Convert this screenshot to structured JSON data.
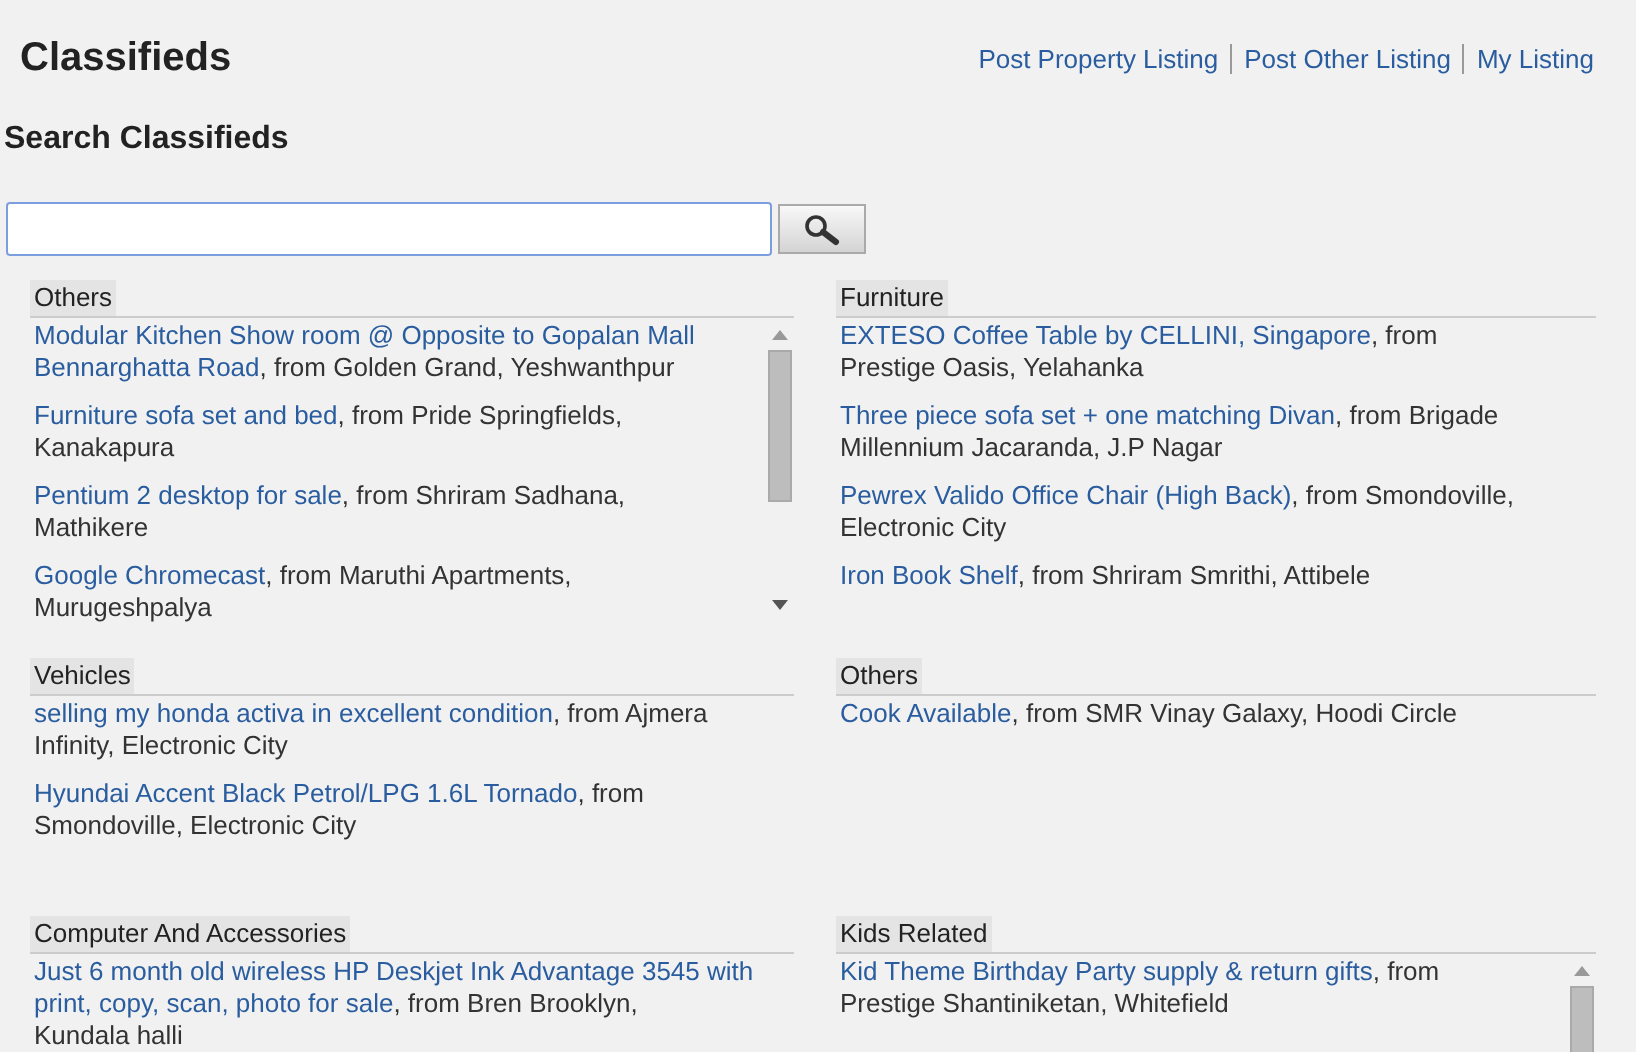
{
  "page": {
    "title": "Classifieds"
  },
  "top_links": [
    "Post Property Listing",
    "Post Other Listing",
    "My Listing"
  ],
  "search": {
    "heading": "Search Classifieds"
  },
  "sections": [
    {
      "title": "Others",
      "scrollbar": true,
      "items": [
        {
          "link": [
            "Modular Kitchen Show room @ Opposite to Gopalan Mall",
            "Bennarghatta Road"
          ],
          "detail": ", from Golden Grand, Yeshwanthpur"
        },
        {
          "link": "Furniture sofa set and bed",
          "detail": ", from Pride Springfields, Kanakapura"
        },
        {
          "link": "Pentium 2 desktop for sale",
          "detail": ", from Shriram Sadhana, Mathikere"
        },
        {
          "link": "Google Chromecast",
          "detail": ", from Maruthi Apartments, Murugeshpalya"
        }
      ]
    },
    {
      "title": "Furniture",
      "items": [
        {
          "link": "EXTESO Coffee Table by CELLINI, Singapore",
          "detail": ", from Prestige Oasis, Yelahanka"
        },
        {
          "link": "Three piece sofa set + one matching Divan",
          "detail": ", from Brigade Millennium Jacaranda, J.P Nagar"
        },
        {
          "link": "Pewrex Valido Office Chair (High Back)",
          "detail": ", from Smondoville, Electronic City"
        },
        {
          "link": "Iron Book Shelf",
          "detail": ", from Shriram Smrithi, Attibele"
        }
      ]
    },
    {
      "title": "Vehicles",
      "items": [
        {
          "link": "selling my honda activa in excellent condition",
          "detail": ", from Ajmera Infinity, Electronic City"
        },
        {
          "link": "Hyundai Accent Black Petrol/LPG 1.6L Tornado",
          "detail": ", from Smondoville, Electronic City"
        }
      ]
    },
    {
      "title": "Others",
      "items": [
        {
          "link": "Cook Available",
          "detail": ", from SMR Vinay Galaxy, Hoodi Circle"
        }
      ]
    },
    {
      "title": "Computer And Accessories",
      "items": [
        {
          "link": [
            "Just 6 month old wireless HP Deskjet Ink Advantage 3545 with",
            "print, copy, scan, photo for sale"
          ],
          "detail": ", from Bren Brooklyn, Kundala halli"
        }
      ]
    },
    {
      "title": "Kids Related",
      "scrollbar": true,
      "items": [
        {
          "link": "Kid Theme Birthday Party supply & return gifts",
          "detail": ", from Prestige Shantiniketan, Whitefield"
        }
      ]
    }
  ]
}
